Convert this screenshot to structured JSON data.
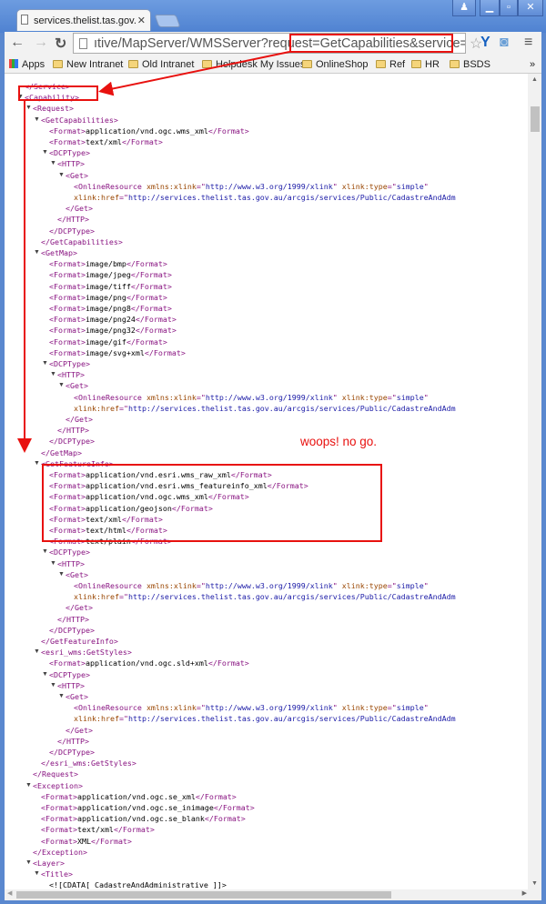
{
  "browser": {
    "tab_title": "services.thelist.tas.gov.au/a",
    "url": "ıtive/MapServer/WMSServer?request=GetCapabilities&service=WMS",
    "bookmarks": [
      "Apps",
      "New Intranet",
      "Old Intranet",
      "Helpdesk My Issues",
      "OnlineShop",
      "Ref",
      "HR",
      "BSDS"
    ],
    "overflow": "»",
    "window_buttons": [
      "user",
      "minimize",
      "maximize",
      "close"
    ]
  },
  "annotation": {
    "note": "woops! no go.",
    "color": "#e8110f"
  },
  "colors": {
    "tag": "#881280",
    "attr": "#994500",
    "value": "#1a1aa6"
  },
  "xml_lines": [
    {
      "l": 0,
      "s": [
        [
          "tag",
          "</Service>"
        ]
      ]
    },
    {
      "l": 0,
      "o": 1,
      "s": [
        [
          "tag",
          "<Capability>"
        ]
      ]
    },
    {
      "l": 1,
      "o": 1,
      "s": [
        [
          "tag",
          "<Request>"
        ]
      ]
    },
    {
      "l": 2,
      "o": 1,
      "s": [
        [
          "tag",
          "<GetCapabilities>"
        ]
      ]
    },
    {
      "l": 3,
      "s": [
        [
          "tag",
          "<Format>"
        ],
        [
          "text",
          "application/vnd.ogc.wms_xml"
        ],
        [
          "tag",
          "</Format>"
        ]
      ]
    },
    {
      "l": 3,
      "s": [
        [
          "tag",
          "<Format>"
        ],
        [
          "text",
          "text/xml"
        ],
        [
          "tag",
          "</Format>"
        ]
      ]
    },
    {
      "l": 3,
      "o": 1,
      "s": [
        [
          "tag",
          "<DCPType>"
        ]
      ]
    },
    {
      "l": 4,
      "o": 1,
      "s": [
        [
          "tag",
          "<HTTP>"
        ]
      ]
    },
    {
      "l": 5,
      "o": 1,
      "s": [
        [
          "tag",
          "<Get>"
        ]
      ]
    },
    {
      "l": 6,
      "s": [
        [
          "tag",
          "<OnlineResource "
        ],
        [
          "attr",
          "xmlns:xlink"
        ],
        [
          "tag",
          "=\""
        ],
        [
          "val",
          "http://www.w3.org/1999/xlink"
        ],
        [
          "tag",
          "\" "
        ],
        [
          "attr",
          "xlink:type"
        ],
        [
          "tag",
          "=\""
        ],
        [
          "val",
          "simple"
        ],
        [
          "tag",
          "\""
        ]
      ]
    },
    {
      "l": 6,
      "s": [
        [
          "attr",
          "xlink:href"
        ],
        [
          "tag",
          "=\""
        ],
        [
          "val",
          "http://services.thelist.tas.gov.au/arcgis/services/Public/CadastreAndAdm"
        ]
      ]
    },
    {
      "l": 5,
      "s": [
        [
          "tag",
          "</Get>"
        ]
      ]
    },
    {
      "l": 4,
      "s": [
        [
          "tag",
          "</HTTP>"
        ]
      ]
    },
    {
      "l": 3,
      "s": [
        [
          "tag",
          "</DCPType>"
        ]
      ]
    },
    {
      "l": 2,
      "s": [
        [
          "tag",
          "</GetCapabilities>"
        ]
      ]
    },
    {
      "l": 2,
      "o": 1,
      "s": [
        [
          "tag",
          "<GetMap>"
        ]
      ]
    },
    {
      "l": 3,
      "s": [
        [
          "tag",
          "<Format>"
        ],
        [
          "text",
          "image/bmp"
        ],
        [
          "tag",
          "</Format>"
        ]
      ]
    },
    {
      "l": 3,
      "s": [
        [
          "tag",
          "<Format>"
        ],
        [
          "text",
          "image/jpeg"
        ],
        [
          "tag",
          "</Format>"
        ]
      ]
    },
    {
      "l": 3,
      "s": [
        [
          "tag",
          "<Format>"
        ],
        [
          "text",
          "image/tiff"
        ],
        [
          "tag",
          "</Format>"
        ]
      ]
    },
    {
      "l": 3,
      "s": [
        [
          "tag",
          "<Format>"
        ],
        [
          "text",
          "image/png"
        ],
        [
          "tag",
          "</Format>"
        ]
      ]
    },
    {
      "l": 3,
      "s": [
        [
          "tag",
          "<Format>"
        ],
        [
          "text",
          "image/png8"
        ],
        [
          "tag",
          "</Format>"
        ]
      ]
    },
    {
      "l": 3,
      "s": [
        [
          "tag",
          "<Format>"
        ],
        [
          "text",
          "image/png24"
        ],
        [
          "tag",
          "</Format>"
        ]
      ]
    },
    {
      "l": 3,
      "s": [
        [
          "tag",
          "<Format>"
        ],
        [
          "text",
          "image/png32"
        ],
        [
          "tag",
          "</Format>"
        ]
      ]
    },
    {
      "l": 3,
      "s": [
        [
          "tag",
          "<Format>"
        ],
        [
          "text",
          "image/gif"
        ],
        [
          "tag",
          "</Format>"
        ]
      ]
    },
    {
      "l": 3,
      "s": [
        [
          "tag",
          "<Format>"
        ],
        [
          "text",
          "image/svg+xml"
        ],
        [
          "tag",
          "</Format>"
        ]
      ]
    },
    {
      "l": 3,
      "o": 1,
      "s": [
        [
          "tag",
          "<DCPType>"
        ]
      ]
    },
    {
      "l": 4,
      "o": 1,
      "s": [
        [
          "tag",
          "<HTTP>"
        ]
      ]
    },
    {
      "l": 5,
      "o": 1,
      "s": [
        [
          "tag",
          "<Get>"
        ]
      ]
    },
    {
      "l": 6,
      "s": [
        [
          "tag",
          "<OnlineResource "
        ],
        [
          "attr",
          "xmlns:xlink"
        ],
        [
          "tag",
          "=\""
        ],
        [
          "val",
          "http://www.w3.org/1999/xlink"
        ],
        [
          "tag",
          "\" "
        ],
        [
          "attr",
          "xlink:type"
        ],
        [
          "tag",
          "=\""
        ],
        [
          "val",
          "simple"
        ],
        [
          "tag",
          "\""
        ]
      ]
    },
    {
      "l": 6,
      "s": [
        [
          "attr",
          "xlink:href"
        ],
        [
          "tag",
          "=\""
        ],
        [
          "val",
          "http://services.thelist.tas.gov.au/arcgis/services/Public/CadastreAndAdm"
        ]
      ]
    },
    {
      "l": 5,
      "s": [
        [
          "tag",
          "</Get>"
        ]
      ]
    },
    {
      "l": 4,
      "s": [
        [
          "tag",
          "</HTTP>"
        ]
      ]
    },
    {
      "l": 3,
      "s": [
        [
          "tag",
          "</DCPType>"
        ]
      ]
    },
    {
      "l": 2,
      "s": [
        [
          "tag",
          "</GetMap>"
        ]
      ]
    },
    {
      "l": 2,
      "o": 1,
      "s": [
        [
          "tag",
          "<GetFeatureInfo>"
        ]
      ]
    },
    {
      "l": 3,
      "s": [
        [
          "tag",
          "<Format>"
        ],
        [
          "text",
          "application/vnd.esri.wms_raw_xml"
        ],
        [
          "tag",
          "</Format>"
        ]
      ]
    },
    {
      "l": 3,
      "s": [
        [
          "tag",
          "<Format>"
        ],
        [
          "text",
          "application/vnd.esri.wms_featureinfo_xml"
        ],
        [
          "tag",
          "</Format>"
        ]
      ]
    },
    {
      "l": 3,
      "s": [
        [
          "tag",
          "<Format>"
        ],
        [
          "text",
          "application/vnd.ogc.wms_xml"
        ],
        [
          "tag",
          "</Format>"
        ]
      ]
    },
    {
      "l": 3,
      "s": [
        [
          "tag",
          "<Format>"
        ],
        [
          "text",
          "application/geojson"
        ],
        [
          "tag",
          "</Format>"
        ]
      ]
    },
    {
      "l": 3,
      "s": [
        [
          "tag",
          "<Format>"
        ],
        [
          "text",
          "text/xml"
        ],
        [
          "tag",
          "</Format>"
        ]
      ]
    },
    {
      "l": 3,
      "s": [
        [
          "tag",
          "<Format>"
        ],
        [
          "text",
          "text/html"
        ],
        [
          "tag",
          "</Format>"
        ]
      ]
    },
    {
      "l": 3,
      "s": [
        [
          "tag",
          "<Format>"
        ],
        [
          "text",
          "text/plain"
        ],
        [
          "tag",
          "</Format>"
        ]
      ]
    },
    {
      "l": 3,
      "o": 1,
      "s": [
        [
          "tag",
          "<DCPType>"
        ]
      ]
    },
    {
      "l": 4,
      "o": 1,
      "s": [
        [
          "tag",
          "<HTTP>"
        ]
      ]
    },
    {
      "l": 5,
      "o": 1,
      "s": [
        [
          "tag",
          "<Get>"
        ]
      ]
    },
    {
      "l": 6,
      "s": [
        [
          "tag",
          "<OnlineResource "
        ],
        [
          "attr",
          "xmlns:xlink"
        ],
        [
          "tag",
          "=\""
        ],
        [
          "val",
          "http://www.w3.org/1999/xlink"
        ],
        [
          "tag",
          "\" "
        ],
        [
          "attr",
          "xlink:type"
        ],
        [
          "tag",
          "=\""
        ],
        [
          "val",
          "simple"
        ],
        [
          "tag",
          "\""
        ]
      ]
    },
    {
      "l": 6,
      "s": [
        [
          "attr",
          "xlink:href"
        ],
        [
          "tag",
          "=\""
        ],
        [
          "val",
          "http://services.thelist.tas.gov.au/arcgis/services/Public/CadastreAndAdm"
        ]
      ]
    },
    {
      "l": 5,
      "s": [
        [
          "tag",
          "</Get>"
        ]
      ]
    },
    {
      "l": 4,
      "s": [
        [
          "tag",
          "</HTTP>"
        ]
      ]
    },
    {
      "l": 3,
      "s": [
        [
          "tag",
          "</DCPType>"
        ]
      ]
    },
    {
      "l": 2,
      "s": [
        [
          "tag",
          "</GetFeatureInfo>"
        ]
      ]
    },
    {
      "l": 2,
      "o": 1,
      "s": [
        [
          "tag",
          "<esri_wms:GetStyles>"
        ]
      ]
    },
    {
      "l": 3,
      "s": [
        [
          "tag",
          "<Format>"
        ],
        [
          "text",
          "application/vnd.ogc.sld+xml"
        ],
        [
          "tag",
          "</Format>"
        ]
      ]
    },
    {
      "l": 3,
      "o": 1,
      "s": [
        [
          "tag",
          "<DCPType>"
        ]
      ]
    },
    {
      "l": 4,
      "o": 1,
      "s": [
        [
          "tag",
          "<HTTP>"
        ]
      ]
    },
    {
      "l": 5,
      "o": 1,
      "s": [
        [
          "tag",
          "<Get>"
        ]
      ]
    },
    {
      "l": 6,
      "s": [
        [
          "tag",
          "<OnlineResource "
        ],
        [
          "attr",
          "xmlns:xlink"
        ],
        [
          "tag",
          "=\""
        ],
        [
          "val",
          "http://www.w3.org/1999/xlink"
        ],
        [
          "tag",
          "\" "
        ],
        [
          "attr",
          "xlink:type"
        ],
        [
          "tag",
          "=\""
        ],
        [
          "val",
          "simple"
        ],
        [
          "tag",
          "\""
        ]
      ]
    },
    {
      "l": 6,
      "s": [
        [
          "attr",
          "xlink:href"
        ],
        [
          "tag",
          "=\""
        ],
        [
          "val",
          "http://services.thelist.tas.gov.au/arcgis/services/Public/CadastreAndAdm"
        ]
      ]
    },
    {
      "l": 5,
      "s": [
        [
          "tag",
          "</Get>"
        ]
      ]
    },
    {
      "l": 4,
      "s": [
        [
          "tag",
          "</HTTP>"
        ]
      ]
    },
    {
      "l": 3,
      "s": [
        [
          "tag",
          "</DCPType>"
        ]
      ]
    },
    {
      "l": 2,
      "s": [
        [
          "tag",
          "</esri_wms:GetStyles>"
        ]
      ]
    },
    {
      "l": 1,
      "s": [
        [
          "tag",
          "</Request>"
        ]
      ]
    },
    {
      "l": 1,
      "o": 1,
      "s": [
        [
          "tag",
          "<Exception>"
        ]
      ]
    },
    {
      "l": 2,
      "s": [
        [
          "tag",
          "<Format>"
        ],
        [
          "text",
          "application/vnd.ogc.se_xml"
        ],
        [
          "tag",
          "</Format>"
        ]
      ]
    },
    {
      "l": 2,
      "s": [
        [
          "tag",
          "<Format>"
        ],
        [
          "text",
          "application/vnd.ogc.se_inimage"
        ],
        [
          "tag",
          "</Format>"
        ]
      ]
    },
    {
      "l": 2,
      "s": [
        [
          "tag",
          "<Format>"
        ],
        [
          "text",
          "application/vnd.ogc.se_blank"
        ],
        [
          "tag",
          "</Format>"
        ]
      ]
    },
    {
      "l": 2,
      "s": [
        [
          "tag",
          "<Format>"
        ],
        [
          "text",
          "text/xml"
        ],
        [
          "tag",
          "</Format>"
        ]
      ]
    },
    {
      "l": 2,
      "s": [
        [
          "tag",
          "<Format>"
        ],
        [
          "text",
          "XML"
        ],
        [
          "tag",
          "</Format>"
        ]
      ]
    },
    {
      "l": 1,
      "s": [
        [
          "tag",
          "</Exception>"
        ]
      ]
    },
    {
      "l": 1,
      "o": 1,
      "s": [
        [
          "tag",
          "<Layer>"
        ]
      ]
    },
    {
      "l": 2,
      "o": 1,
      "s": [
        [
          "tag",
          "<Title>"
        ]
      ]
    },
    {
      "l": 3,
      "s": [
        [
          "text",
          "<![CDATA[ CadastreAndAdministrative ]]>"
        ]
      ]
    }
  ]
}
